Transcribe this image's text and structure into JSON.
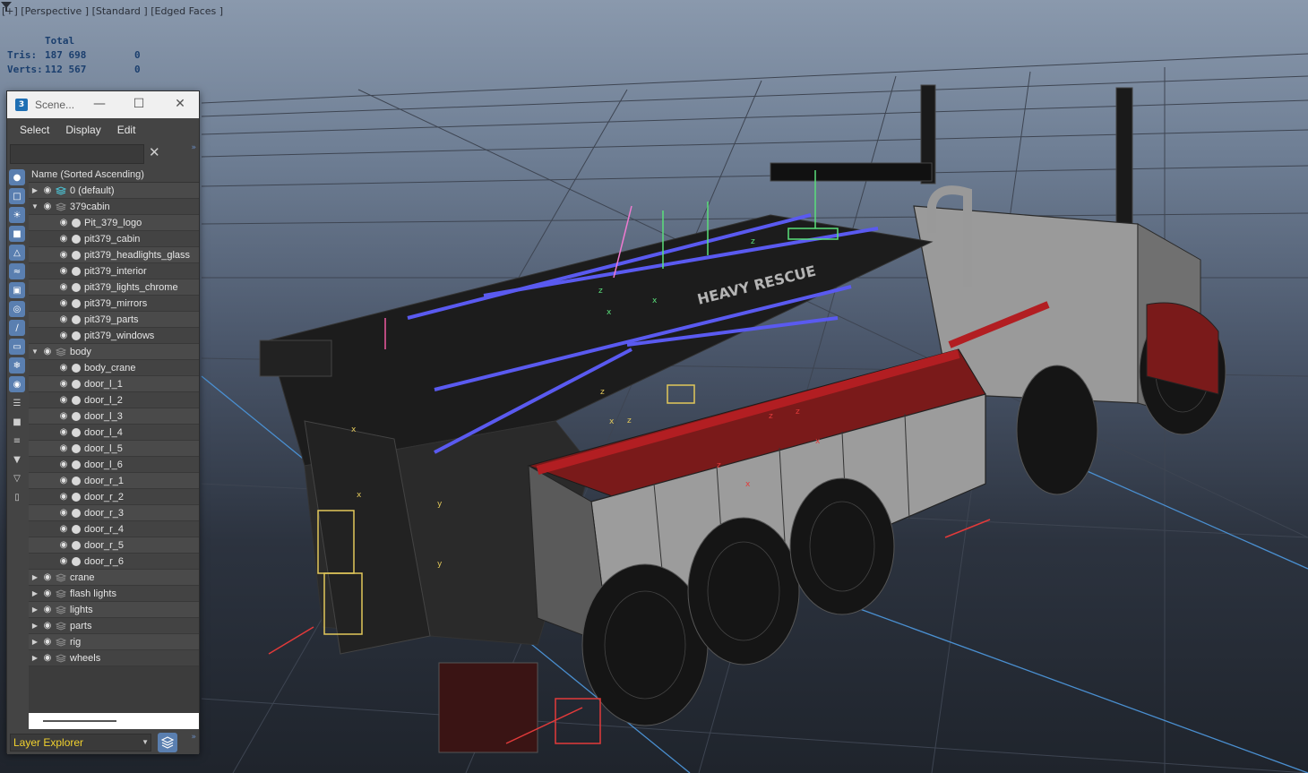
{
  "viewport": {
    "label": "[+] [Perspective ] [Standard ] [Edged Faces ]",
    "filter_icon": "filter-icon",
    "stats": {
      "header": "Total",
      "tris_label": "Tris:",
      "tris_total": "187 698",
      "tris_sel": "0",
      "verts_label": "Verts:",
      "verts_total": "112 567",
      "verts_sel": "0"
    },
    "decal_text": "HEAVY RESCUE"
  },
  "scene_explorer": {
    "title": "Scene...",
    "app_icon": "3",
    "menu": [
      "Select",
      "Display",
      "Edit"
    ],
    "search_placeholder": "",
    "column_header": "Name (Sorted Ascending)",
    "rows": [
      {
        "label": "0 (default)",
        "level": 0,
        "expander": "collapsed",
        "kind": "layer-active"
      },
      {
        "label": "379cabin",
        "level": 0,
        "expander": "expanded",
        "kind": "layer"
      },
      {
        "label": "Pit_379_logo",
        "level": 1,
        "kind": "object"
      },
      {
        "label": "pit379_cabin",
        "level": 1,
        "kind": "object"
      },
      {
        "label": "pit379_headlights_glass",
        "level": 1,
        "kind": "object"
      },
      {
        "label": "pit379_interior",
        "level": 1,
        "kind": "object"
      },
      {
        "label": "pit379_lights_chrome",
        "level": 1,
        "kind": "object"
      },
      {
        "label": "pit379_mirrors",
        "level": 1,
        "kind": "object"
      },
      {
        "label": "pit379_parts",
        "level": 1,
        "kind": "object"
      },
      {
        "label": "pit379_windows",
        "level": 1,
        "kind": "object"
      },
      {
        "label": "body",
        "level": 0,
        "expander": "expanded",
        "kind": "layer"
      },
      {
        "label": "body_crane",
        "level": 1,
        "kind": "object"
      },
      {
        "label": "door_l_1",
        "level": 1,
        "kind": "object"
      },
      {
        "label": "door_l_2",
        "level": 1,
        "kind": "object"
      },
      {
        "label": "door_l_3",
        "level": 1,
        "kind": "object"
      },
      {
        "label": "door_l_4",
        "level": 1,
        "kind": "object"
      },
      {
        "label": "door_l_5",
        "level": 1,
        "kind": "object"
      },
      {
        "label": "door_l_6",
        "level": 1,
        "kind": "object"
      },
      {
        "label": "door_r_1",
        "level": 1,
        "kind": "object"
      },
      {
        "label": "door_r_2",
        "level": 1,
        "kind": "object"
      },
      {
        "label": "door_r_3",
        "level": 1,
        "kind": "object"
      },
      {
        "label": "door_r_4",
        "level": 1,
        "kind": "object"
      },
      {
        "label": "door_r_5",
        "level": 1,
        "kind": "object"
      },
      {
        "label": "door_r_6",
        "level": 1,
        "kind": "object"
      },
      {
        "label": "crane",
        "level": 0,
        "expander": "collapsed",
        "kind": "layer"
      },
      {
        "label": "flash lights",
        "level": 0,
        "expander": "collapsed",
        "kind": "layer"
      },
      {
        "label": "lights",
        "level": 0,
        "expander": "collapsed",
        "kind": "layer"
      },
      {
        "label": "parts",
        "level": 0,
        "expander": "collapsed",
        "kind": "layer"
      },
      {
        "label": "rig",
        "level": 0,
        "expander": "collapsed",
        "kind": "layer"
      },
      {
        "label": "wheels",
        "level": 0,
        "expander": "collapsed",
        "kind": "layer"
      }
    ],
    "explorer_mode": "Layer Explorer",
    "tools": [
      "display-all-icon",
      "geometry-icon",
      "light-icon",
      "camera-icon",
      "helper-icon",
      "spacewarp-icon",
      "group-icon",
      "xref-icon",
      "bone-icon",
      "container-icon",
      "frozen-icon",
      "hidden-icon",
      "list-icon",
      "list-solid-icon",
      "list-lines-icon",
      "filter-edit-icon",
      "filter-icon",
      "select-icon"
    ],
    "colors": {
      "accent": "#5a7fb0",
      "explorer_text": "#f2d22e"
    }
  }
}
